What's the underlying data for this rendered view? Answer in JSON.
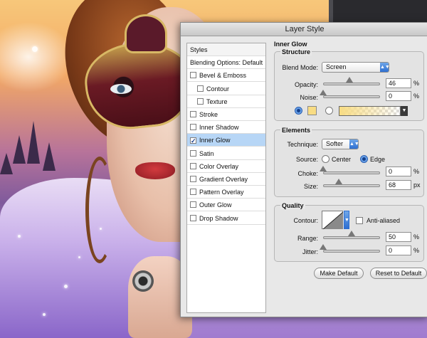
{
  "window": {
    "title": "Layer Style"
  },
  "styles_list": {
    "items": [
      {
        "label": "Styles",
        "checkbox": false,
        "checked": false,
        "indent": false,
        "selected": false
      },
      {
        "label": "Blending Options: Default",
        "checkbox": false,
        "checked": false,
        "indent": false,
        "selected": false
      },
      {
        "label": "Bevel & Emboss",
        "checkbox": true,
        "checked": false,
        "indent": false,
        "selected": false
      },
      {
        "label": "Contour",
        "checkbox": true,
        "checked": false,
        "indent": true,
        "selected": false
      },
      {
        "label": "Texture",
        "checkbox": true,
        "checked": false,
        "indent": true,
        "selected": false
      },
      {
        "label": "Stroke",
        "checkbox": true,
        "checked": false,
        "indent": false,
        "selected": false
      },
      {
        "label": "Inner Shadow",
        "checkbox": true,
        "checked": false,
        "indent": false,
        "selected": false
      },
      {
        "label": "Inner Glow",
        "checkbox": true,
        "checked": true,
        "indent": false,
        "selected": true
      },
      {
        "label": "Satin",
        "checkbox": true,
        "checked": false,
        "indent": false,
        "selected": false
      },
      {
        "label": "Color Overlay",
        "checkbox": true,
        "checked": false,
        "indent": false,
        "selected": false
      },
      {
        "label": "Gradient Overlay",
        "checkbox": true,
        "checked": false,
        "indent": false,
        "selected": false
      },
      {
        "label": "Pattern Overlay",
        "checkbox": true,
        "checked": false,
        "indent": false,
        "selected": false
      },
      {
        "label": "Outer Glow",
        "checkbox": true,
        "checked": false,
        "indent": false,
        "selected": false
      },
      {
        "label": "Drop Shadow",
        "checkbox": true,
        "checked": false,
        "indent": false,
        "selected": false
      }
    ]
  },
  "panel": {
    "title": "Inner Glow",
    "structure": {
      "label": "Structure",
      "blend_mode_label": "Blend Mode:",
      "blend_mode_value": "Screen",
      "opacity_label": "Opacity:",
      "opacity_value": "46",
      "opacity_unit": "%",
      "opacity_level": 0.46,
      "noise_label": "Noise:",
      "noise_value": "0",
      "noise_unit": "%",
      "noise_level": 0,
      "glow_color": "#f8dc83"
    },
    "elements": {
      "label": "Elements",
      "technique_label": "Technique:",
      "technique_value": "Softer",
      "source_label": "Source:",
      "source_center": "Center",
      "source_edge": "Edge",
      "source_selected": "Edge",
      "choke_label": "Choke:",
      "choke_value": "0",
      "choke_unit": "%",
      "choke_level": 0,
      "size_label": "Size:",
      "size_value": "68",
      "size_unit": "px",
      "size_level": 0.27
    },
    "quality": {
      "label": "Quality",
      "contour_label": "Contour:",
      "anti_aliased_label": "Anti-aliased",
      "anti_aliased_checked": false,
      "range_label": "Range:",
      "range_value": "50",
      "range_unit": "%",
      "range_level": 0.5,
      "jitter_label": "Jitter:",
      "jitter_value": "0",
      "jitter_unit": "%",
      "jitter_level": 0
    },
    "buttons": {
      "make_default": "Make Default",
      "reset_to_default": "Reset to Default"
    }
  }
}
